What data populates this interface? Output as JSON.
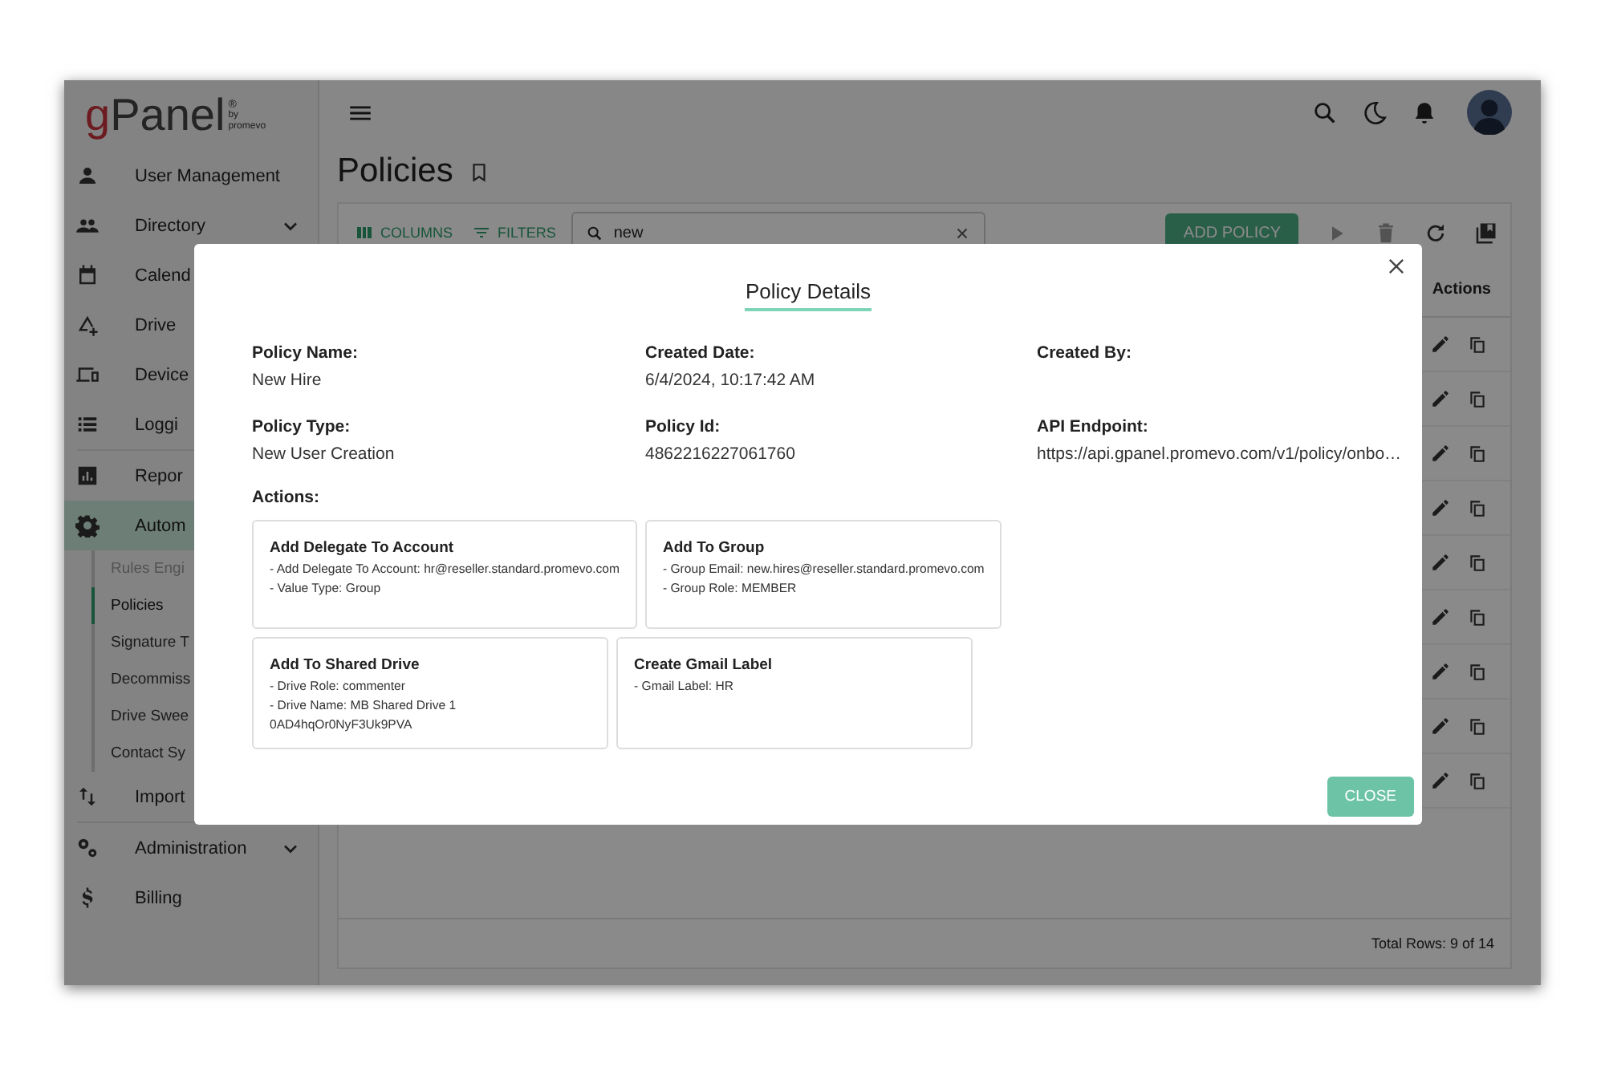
{
  "logo": {
    "letter": "g",
    "name": "Panel",
    "mark": "®",
    "by": "by",
    "brand": "promevo"
  },
  "sidebar": {
    "items": [
      {
        "label": "User Management",
        "selected": false
      },
      {
        "label": "Directory",
        "selected": false,
        "expanded": false
      },
      {
        "label": "Calend",
        "selected": false
      },
      {
        "label": "Drive",
        "selected": false
      },
      {
        "label": "Device",
        "selected": false
      },
      {
        "label": "Loggi",
        "selected": false
      },
      {
        "label": "Repor",
        "selected": false
      },
      {
        "label": "Autom",
        "selected": true,
        "children": [
          {
            "label": "Rules Engi",
            "selected": false,
            "disabled": true
          },
          {
            "label": "Policies",
            "selected": true,
            "disabled": false
          },
          {
            "label": "Signature T",
            "selected": false,
            "disabled": false
          },
          {
            "label": "Decommiss",
            "selected": false,
            "disabled": false
          },
          {
            "label": "Drive Swee",
            "selected": false,
            "disabled": false
          },
          {
            "label": "Contact Sy",
            "selected": false,
            "disabled": false
          }
        ]
      },
      {
        "label": "Import",
        "selected": false
      },
      {
        "label": "Administration",
        "selected": false,
        "expanded": false
      },
      {
        "label": "Billing",
        "selected": false
      }
    ]
  },
  "page": {
    "title": "Policies"
  },
  "toolbar": {
    "columns_button": "COLUMNS",
    "filters_button": "FILTERS",
    "search": {
      "value": "new"
    },
    "add_button": "ADD POLICY"
  },
  "table": {
    "columns": [
      "Actions"
    ],
    "rows": [
      {
        "kind": "policy"
      },
      {
        "kind": "policy"
      },
      {
        "kind": "policy"
      },
      {
        "kind": "policy"
      },
      {
        "kind": "policy"
      },
      {
        "kind": "policy"
      },
      {
        "kind": "policy"
      },
      {
        "kind": "policy"
      },
      {
        "kind": "policy"
      }
    ],
    "footer": "Total Rows: 9 of 14"
  },
  "modal": {
    "title": "Policy Details",
    "fields": [
      {
        "label": "Policy Name:",
        "value": "New Hire"
      },
      {
        "label": "Created Date:",
        "value": "6/4/2024, 10:17:42 AM"
      },
      {
        "label": "Created By:"
      },
      {
        "label": "Policy Type:",
        "value": "New User Creation"
      },
      {
        "label": "Policy Id:",
        "value": "4862216227061760"
      },
      {
        "label": "API Endpoint:",
        "value": "https://api.gpanel.promevo.com/v1/policy/onbo…"
      }
    ],
    "actions_label": "Actions:",
    "actions": [
      {
        "title": "Add Delegate To Account",
        "lines": [
          "- Add Delegate To Account: hr@reseller.standard.promevo.com",
          "- Value Type: Group"
        ]
      },
      {
        "title": "Add To Group",
        "lines": [
          "- Group Email: new.hires@reseller.standard.promevo.com",
          "- Group Role: MEMBER"
        ]
      },
      {
        "title": "Add To Shared Drive",
        "lines": [
          "- Drive Role: commenter",
          "- Drive Name: MB Shared Drive 1",
          "0AD4hqOr0NyF3Uk9PVA"
        ]
      },
      {
        "title": "Create Gmail Label",
        "lines": [
          "- Gmail Label: HR"
        ]
      }
    ],
    "close_button": "CLOSE"
  }
}
